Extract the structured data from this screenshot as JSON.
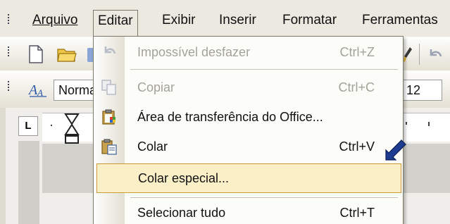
{
  "menubar": {
    "items": [
      "Arquivo",
      "Editar",
      "Exibir",
      "Inserir",
      "Formatar",
      "Ferramentas"
    ],
    "active": "Editar"
  },
  "format_toolbar": {
    "style_value": "Norma",
    "size_value": "12"
  },
  "ruler": {
    "tab_selector": "L"
  },
  "edit_menu": {
    "items": [
      {
        "label": "Impossível desfazer",
        "shortcut": "Ctrl+Z",
        "enabled": false,
        "icon": "undo-icon"
      },
      {
        "label": "Copiar",
        "shortcut": "Ctrl+C",
        "enabled": false,
        "icon": "copy-icon"
      },
      {
        "label": "Área de transferência do Office...",
        "shortcut": "",
        "enabled": true,
        "icon": "clipboard-office-icon"
      },
      {
        "label": "Colar",
        "shortcut": "Ctrl+V",
        "enabled": true,
        "icon": "paste-icon"
      },
      {
        "label": "Colar especial...",
        "shortcut": "",
        "enabled": true,
        "icon": "",
        "highlighted": true
      },
      {
        "label": "Selecionar tudo",
        "shortcut": "Ctrl+T",
        "enabled": true,
        "icon": ""
      }
    ]
  },
  "colors": {
    "highlight_bg": "#fbefc8",
    "highlight_border": "#c79a3a",
    "pointer_arrow": "#1d3b8f"
  }
}
